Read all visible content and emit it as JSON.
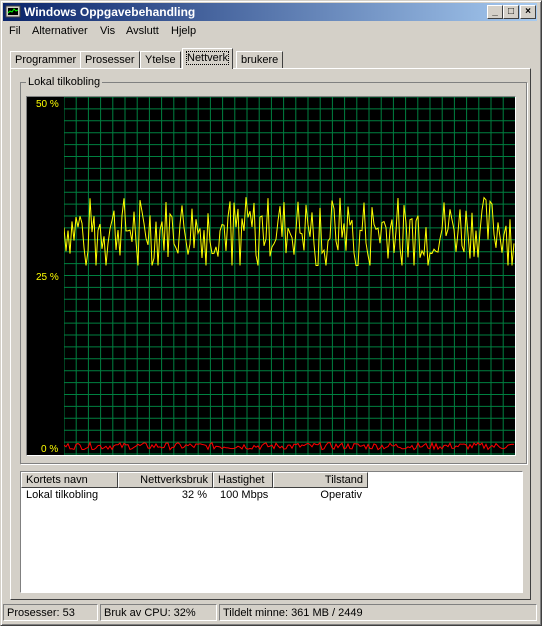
{
  "window": {
    "title": "Windows Oppgavebehandling"
  },
  "menu": [
    "Fil",
    "Alternativer",
    "Vis",
    "Avslutt",
    "Hjelp"
  ],
  "tabs": [
    "Programmer",
    "Prosesser",
    "Ytelse",
    "Nettverk",
    "brukere"
  ],
  "active_tab": "Nettverk",
  "graph": {
    "label": "Lokal tilkobling",
    "y_labels": {
      "top": "50 %",
      "mid": "25 %",
      "bottom": "0 %"
    },
    "colors": {
      "grid": "#008040",
      "sent": "#ffff00",
      "received": "#ff0000",
      "background": "#000000"
    }
  },
  "chart_data": {
    "type": "line",
    "ylim": [
      0,
      50
    ],
    "series": [
      {
        "color": "#ffff00",
        "mean": 32,
        "min": 28,
        "max": 37
      },
      {
        "color": "#ff0000",
        "mean": 0.7,
        "min": 0.2,
        "max": 1.2
      }
    ]
  },
  "table": {
    "columns": [
      "Kortets navn",
      "Nettverksbruk",
      "Hastighet",
      "Tilstand"
    ],
    "rows": [
      [
        "Lokal tilkobling",
        "32 %",
        "100 Mbps",
        "Operativ"
      ]
    ]
  },
  "status": {
    "processes": "Prosesser: 53",
    "cpu": "Bruk av CPU: 32%",
    "memory": "Tildelt minne: 361 MB / 2449"
  }
}
